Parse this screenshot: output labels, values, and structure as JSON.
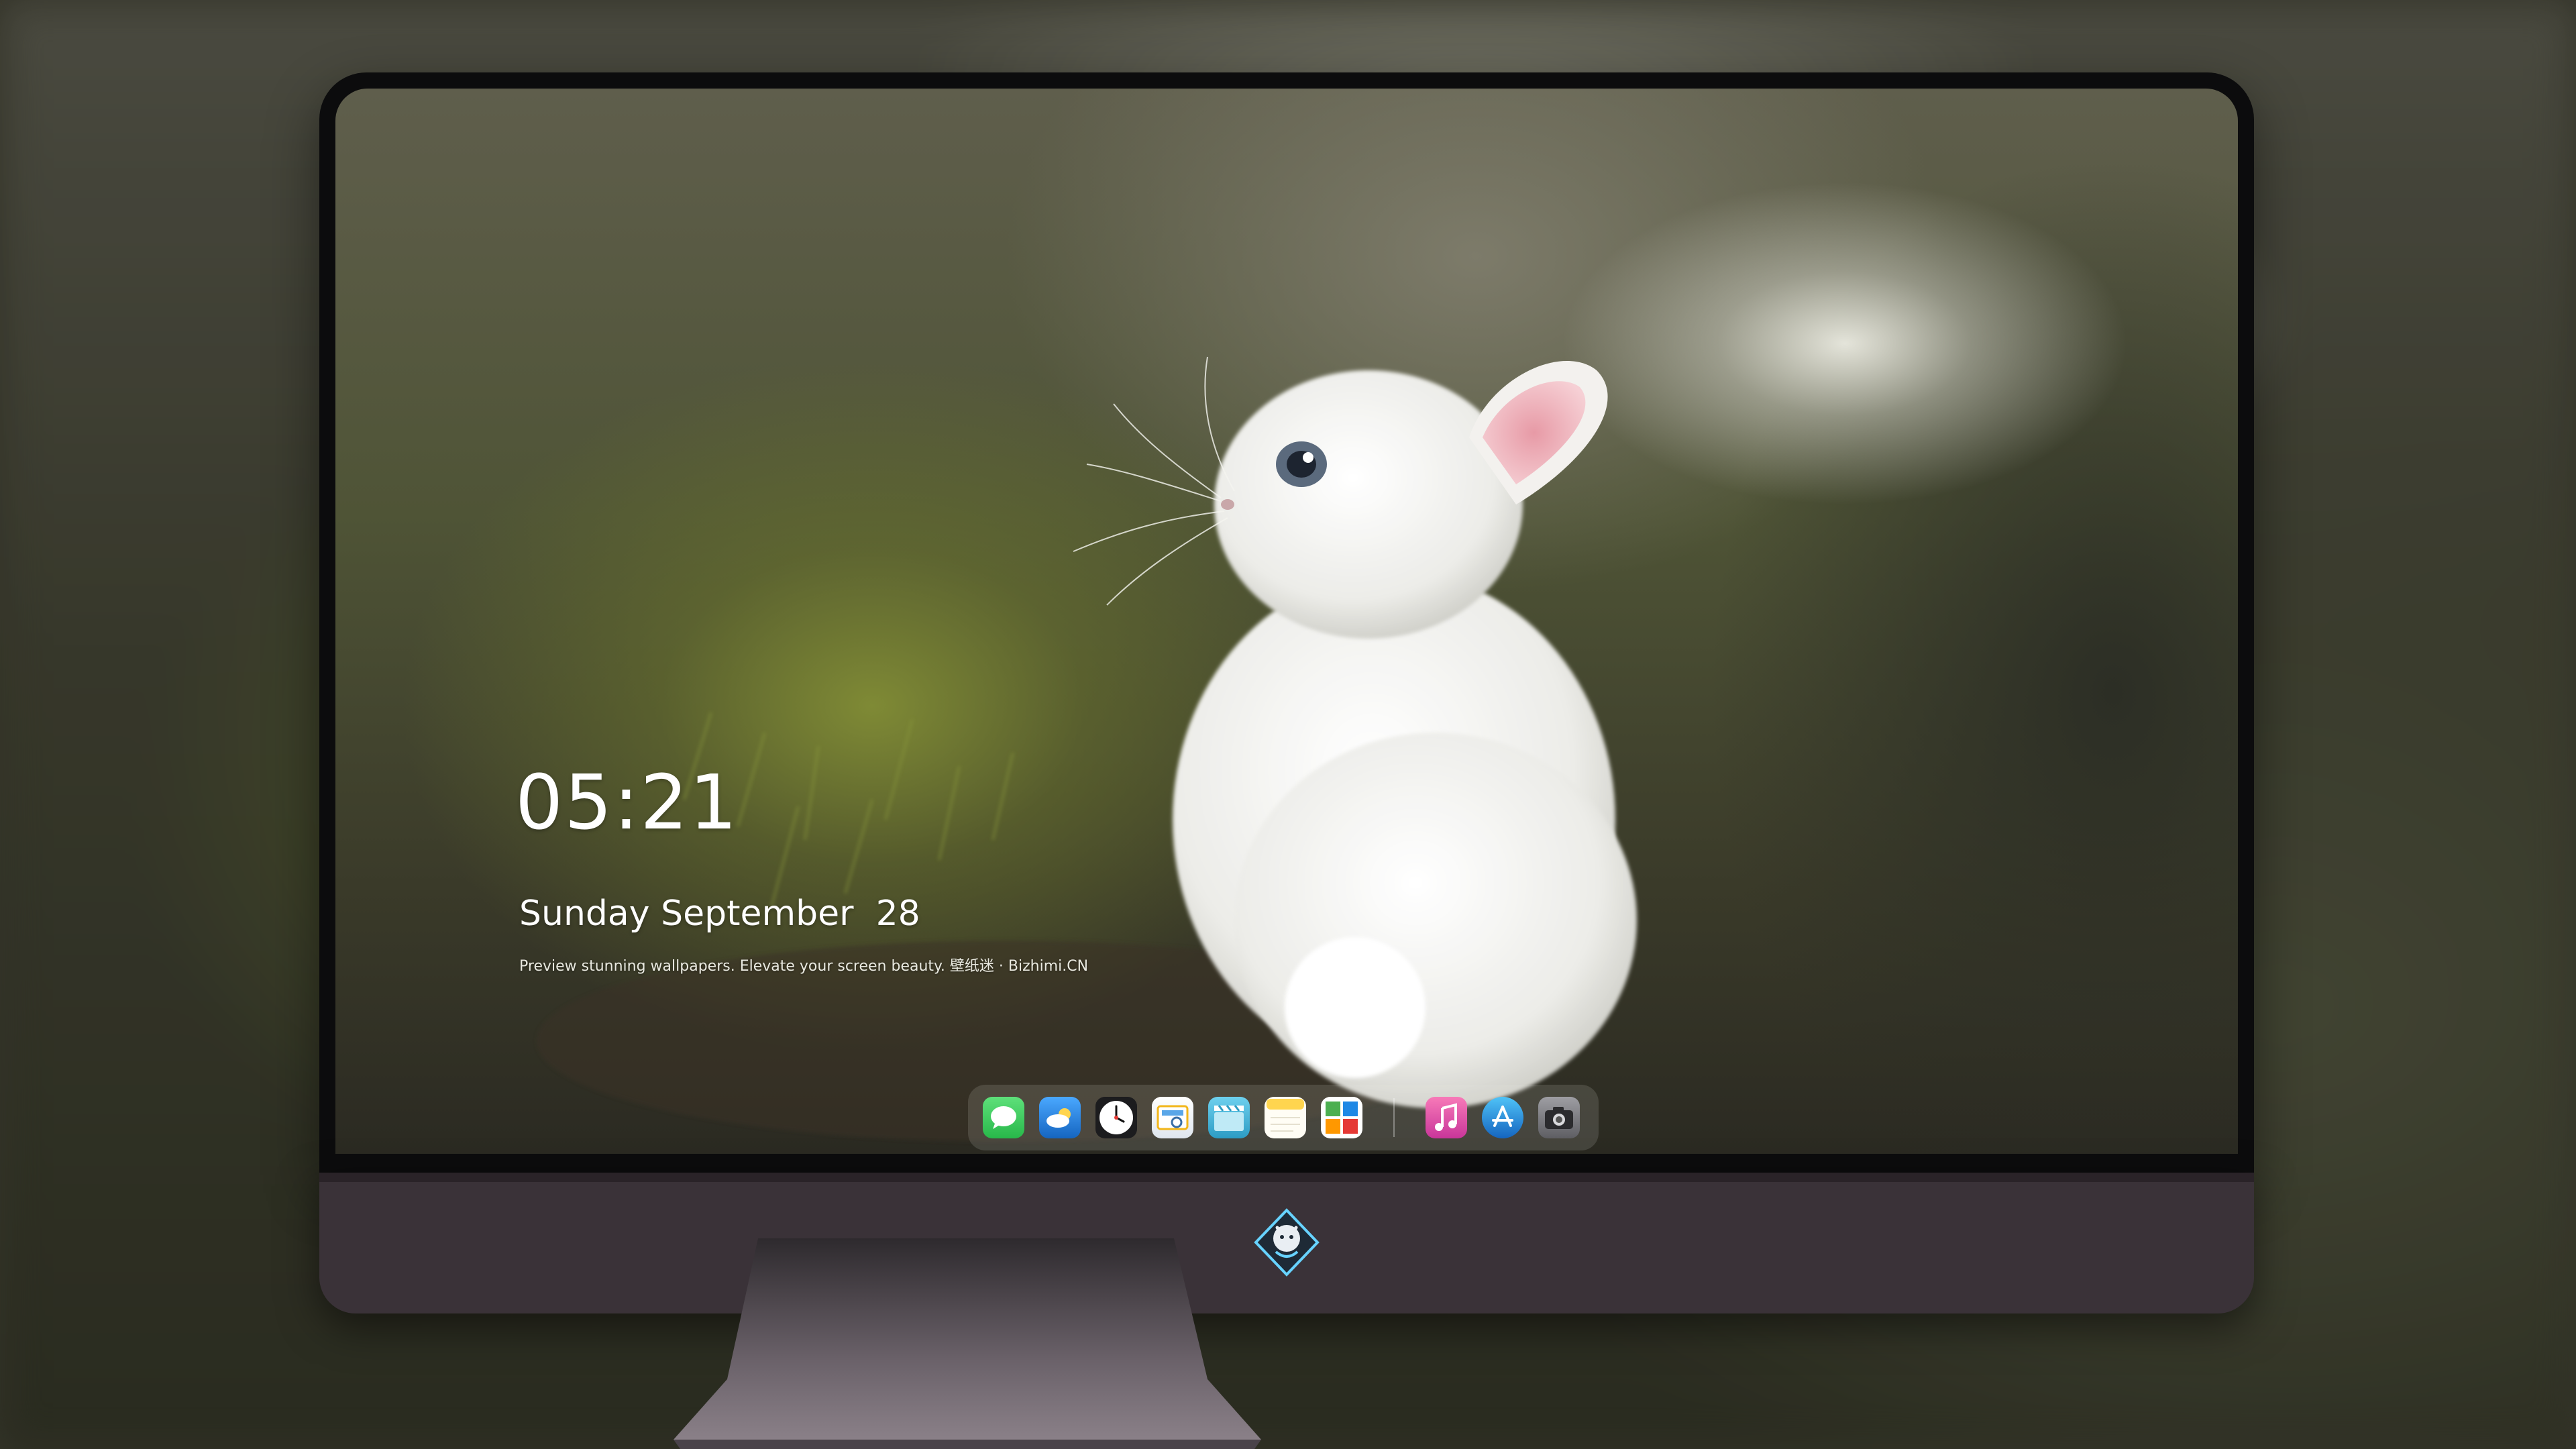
{
  "lockscreen": {
    "time": "05:21",
    "date": "Sunday September  28",
    "tagline": "Preview stunning wallpapers. Elevate your screen beauty. 壁纸迷 · Bizhimi.CN"
  },
  "dock": {
    "apps": [
      {
        "name": "Messages",
        "icon": "messages-icon",
        "color": "#35c759"
      },
      {
        "name": "Weather",
        "icon": "weather-icon",
        "color": "#1e88e5"
      },
      {
        "name": "Clock",
        "icon": "clock-icon",
        "color": "#ffffff"
      },
      {
        "name": "Preview",
        "icon": "preview-icon",
        "color": "#f2c94c"
      },
      {
        "name": "Final Cut",
        "icon": "clapperboard-icon",
        "color": "#48b6d8"
      },
      {
        "name": "Notes",
        "icon": "notes-icon",
        "color": "#ffd54f"
      },
      {
        "name": "Photo Booth",
        "icon": "photo-icon",
        "color": "#e53935"
      },
      {
        "name": "Music",
        "icon": "music-icon",
        "color": "#ec4c9b"
      },
      {
        "name": "App Store",
        "icon": "app-store-icon",
        "color": "#1e88e5"
      },
      {
        "name": "Camera",
        "icon": "camera-icon",
        "color": "#8e8e93"
      }
    ]
  },
  "brand": {
    "logo": "bizhimi-logo"
  }
}
